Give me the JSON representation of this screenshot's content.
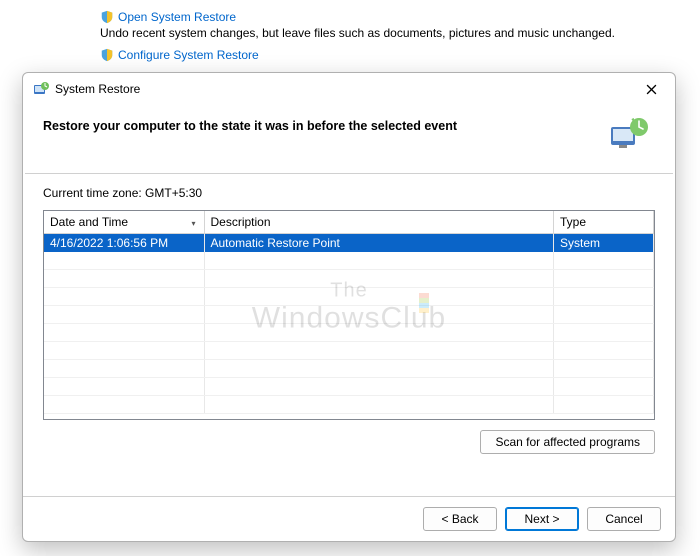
{
  "bg": {
    "open_link": "Open System Restore",
    "open_desc": "Undo recent system changes, but leave files such as documents, pictures and music unchanged.",
    "configure_link": "Configure System Restore"
  },
  "dialog": {
    "title": "System Restore",
    "heading": "Restore your computer to the state it was in before the selected event",
    "timezone_label": "Current time zone: GMT+5:30",
    "columns": {
      "datetime": "Date and Time",
      "description": "Description",
      "type": "Type"
    },
    "row": {
      "datetime": "4/16/2022 1:06:56 PM",
      "description": "Automatic Restore Point",
      "type": "System"
    },
    "scan_button": "Scan for affected programs",
    "back_button": "< Back",
    "next_button": "Next >",
    "cancel_button": "Cancel"
  },
  "watermark": {
    "line1": "The",
    "line2": "WindowsClub"
  }
}
